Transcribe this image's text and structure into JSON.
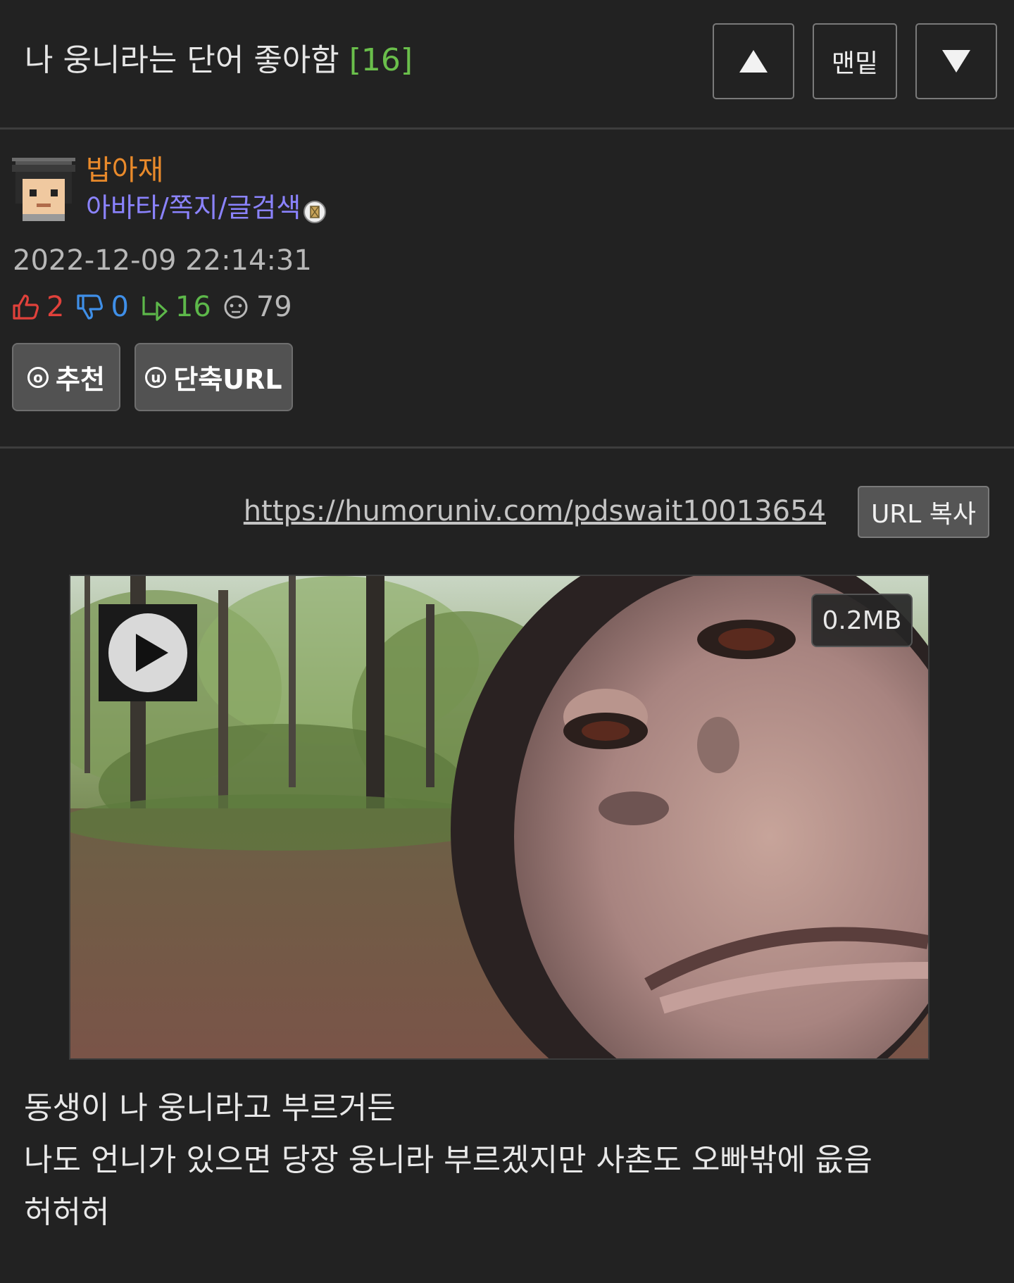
{
  "header": {
    "title": "나 웅니라는 단어 좋아함",
    "comment_count": "[16]",
    "nav_bottom_label": "맨밑",
    "nav_up_icon": "triangle-up-icon",
    "nav_down_icon": "triangle-down-icon"
  },
  "author": {
    "name": "밥아재",
    "links": "아바타/쪽지/글검색",
    "avatar_icon": "pixel-avatar",
    "badge_icon": "member-badge-icon"
  },
  "post": {
    "date": "2022-12-09 22:14:31",
    "stats": {
      "likes": "2",
      "dislikes": "0",
      "comments": "16",
      "views": "79"
    },
    "recommend_label": "추천",
    "recommend_icon_letter": "o",
    "short_url_label": "단축URL",
    "short_url_icon_letter": "u",
    "url": "https://humoruniv.com/pdswait10013654",
    "url_copy_label": "URL 복사",
    "media_size": "0.2MB",
    "body_lines": [
      "동생이 나 웅니라고 부르거든",
      "나도 언니가 있으면 당장 웅니라 부르겠지만 사촌도 오빠밖에 읎음",
      "허허허"
    ]
  },
  "colors": {
    "background": "#222222",
    "comment_count": "#6abf4b",
    "author_name": "#e98a2b",
    "author_links": "#8b83ff",
    "likes": "#e0413b",
    "dislikes": "#3f8fe8",
    "comments": "#5db84a"
  }
}
